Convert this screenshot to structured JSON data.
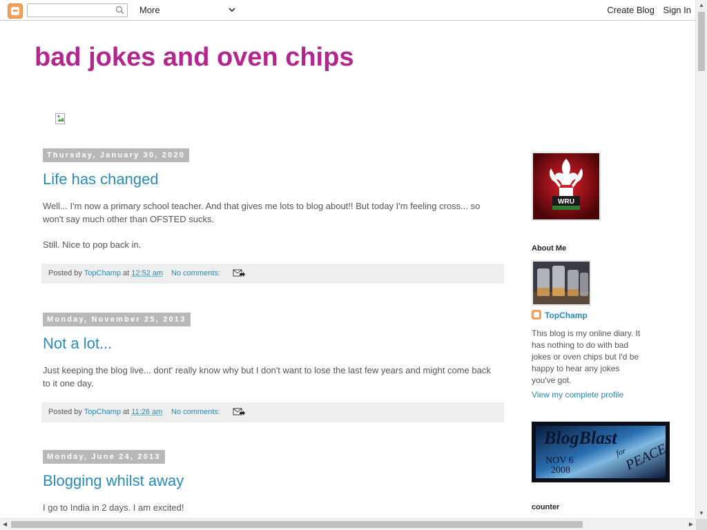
{
  "navbar": {
    "search_placeholder": "",
    "more_label": "More",
    "create_blog": "Create Blog",
    "sign_in": "Sign In"
  },
  "blog": {
    "title": "bad jokes and oven chips"
  },
  "posts": [
    {
      "date": "Thursday, January 30, 2020",
      "title": "Life has changed",
      "paragraphs": [
        "Well... I'm now a primary school teacher. And that gives me lots to blog about!! But today I'm feeling cross... so won't say much other than OFSTED sucks.",
        "Still. Nice to pop back in."
      ],
      "posted_by_prefix": "Posted by",
      "author": "TopChamp",
      "at": "at",
      "time": "12:52 am",
      "comments": "No comments:"
    },
    {
      "date": "Monday, November 25, 2013",
      "title": "Not a lot...",
      "paragraphs": [
        "Just keeping the blog live... dont' really know why but I don't want to lose the last few years and might come back to it one day."
      ],
      "posted_by_prefix": "Posted by",
      "author": "TopChamp",
      "at": "at",
      "time": "11:26 am",
      "comments": "No comments:"
    },
    {
      "date": "Monday, June 24, 2013",
      "title": "Blogging whilst away",
      "paragraphs": [
        "I go to India in 2 days.  I am excited!"
      ]
    }
  ],
  "sidebar": {
    "wru_logo_text": "WRU",
    "about_heading": "About Me",
    "profile_name": "TopChamp",
    "about_text": "This blog is my online diary. It has nothing to do with bad jokes or oven chips but I'd be happy to hear any jokes you've got.",
    "profile_link": "View my complete profile",
    "blogblast_title": "BlogBlast",
    "blogblast_for": "for",
    "blogblast_peace": "PEACE",
    "blogblast_date": "NOV 6",
    "blogblast_year": "2008",
    "counter_heading": "counter"
  },
  "colors": {
    "title": "#b3268e",
    "link": "#2a8ab8",
    "date_bg": "#b8b8b8",
    "footer_bg": "#eeeeee"
  }
}
